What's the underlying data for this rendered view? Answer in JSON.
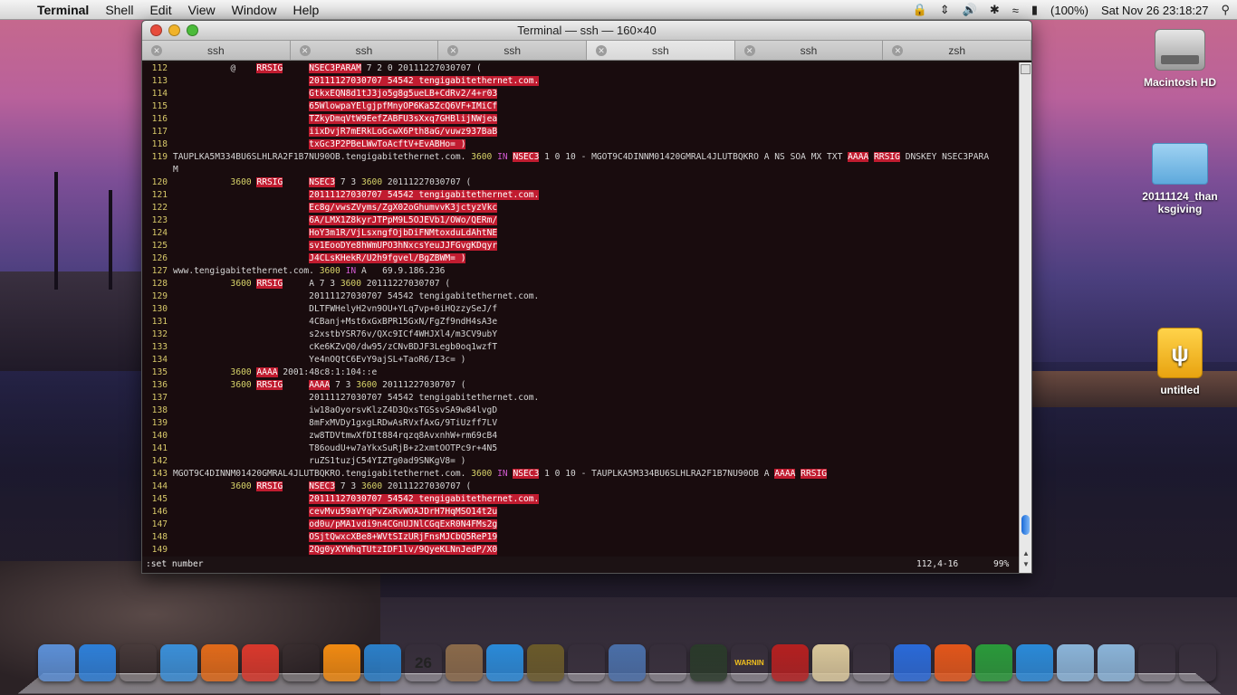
{
  "menubar": {
    "app_name": "Terminal",
    "menus": [
      "Shell",
      "Edit",
      "View",
      "Window",
      "Help"
    ],
    "battery": "(100%)",
    "clock": "Sat Nov 26  23:18:27"
  },
  "desktop": {
    "icons": [
      "Macintosh HD",
      "20111124_thanksgiving",
      "untitled"
    ],
    "icon_label_2a": "20111124_than",
    "icon_label_2b": "ksgiving"
  },
  "window": {
    "title": "Terminal — ssh — 160×40",
    "tabs": [
      "ssh",
      "ssh",
      "ssh",
      "ssh",
      "ssh",
      "zsh"
    ],
    "active_tab": 3
  },
  "terminal": {
    "lines": [
      {
        "n": "112",
        "t": "           @    RRSIG     NSEC3PARAM 7 2 0 20111227030707 ("
      },
      {
        "n": "113",
        "t": "                          20111127030707 54542 tengigabitethernet.com."
      },
      {
        "n": "114",
        "t": "                          GtkxEQN8d1tJ3jo5g8g5ueLB+CdRv2/4+r03"
      },
      {
        "n": "115",
        "t": "                          65WlowpaYElgjpfMnyOP6Ka5ZcQ6VF+IMiCf"
      },
      {
        "n": "116",
        "t": "                          TZkyDmqVtW9EefZABFU3sXxq7GHBlijNWjea"
      },
      {
        "n": "117",
        "t": "                          iixDvjR7mERkLoGcwX6Pth8aG/vuwz937BaB"
      },
      {
        "n": "118",
        "t": "                          txGc3P2PBeLWwToAcftV+EvABHo= )"
      },
      {
        "n": "119",
        "t": "TAUPLKA5M334BU6SLHLRA2F1B7NU90OB.tengigabitethernet.com. 3600 IN NSEC3 1 0 10 - MGOT9C4DINNM01420GMRAL4JLUTBQKRO A NS SOA MX TXT AAAA RRSIG DNSKEY NSEC3PARA"
      },
      {
        "n": "",
        "t": "M"
      },
      {
        "n": "120",
        "t": "           3600 RRSIG     NSEC3 7 3 3600 20111227030707 ("
      },
      {
        "n": "121",
        "t": "                          20111127030707 54542 tengigabitethernet.com."
      },
      {
        "n": "122",
        "t": "                          Ec8g/vwsZVyms/ZgX02oGhumvvK3jctyzVkc"
      },
      {
        "n": "123",
        "t": "                          6A/LMX1Z8kyrJTPpM9L5OJEVb1/OWo/QERm/"
      },
      {
        "n": "124",
        "t": "                          HoY3m1R/VjLsxngfOjbDiFNMtoxduLdAhtNE"
      },
      {
        "n": "125",
        "t": "                          sv1EooDYe8hWmUPO3hNxcsYeuJJFGvgKDqyr"
      },
      {
        "n": "126",
        "t": "                          J4CLsKHekR/U2h9fgvel/BgZBWM= )"
      },
      {
        "n": "127",
        "t": "www.tengigabitethernet.com. 3600 IN A   69.9.186.236"
      },
      {
        "n": "128",
        "t": "           3600 RRSIG     A 7 3 3600 20111227030707 ("
      },
      {
        "n": "129",
        "t": "                          20111127030707 54542 tengigabitethernet.com."
      },
      {
        "n": "130",
        "t": "                          DLTFWHelyH2vn9OU+YLq7vp+0iHQzzySeJ/f"
      },
      {
        "n": "131",
        "t": "                          4CBanj+Mst6xGxBPR15GxN/FgZf9ndH4sA3e"
      },
      {
        "n": "132",
        "t": "                          s2xstbYSR76v/QXc9ICf4WHJXl4/m3CV9ubY"
      },
      {
        "n": "133",
        "t": "                          cKe6KZvQ0/dw95/zCNvBDJF3Legb0oq1wzfT"
      },
      {
        "n": "134",
        "t": "                          Ye4nOQtC6EvY9ajSL+TaoR6/I3c= )"
      },
      {
        "n": "135",
        "t": "           3600 AAAA 2001:48c8:1:104::e"
      },
      {
        "n": "136",
        "t": "           3600 RRSIG     AAAA 7 3 3600 20111227030707 ("
      },
      {
        "n": "137",
        "t": "                          20111127030707 54542 tengigabitethernet.com."
      },
      {
        "n": "138",
        "t": "                          iw18aOyorsvKlzZ4D3QxsTGSsvSA9w84lvgD"
      },
      {
        "n": "139",
        "t": "                          8mFxMVDy1gxgLRDwAsRVxfAxG/9TiUzff7LV"
      },
      {
        "n": "140",
        "t": "                          zw8TDVtmwXfDIt884rqzq8AvxnhW+rm69cB4"
      },
      {
        "n": "141",
        "t": "                          T86oudU+w7aYkxSuRjB+z2xmtOOTPc9r+4N5"
      },
      {
        "n": "142",
        "t": "                          ruZS1tuzjC54YIZTg0ad9SNKgV8= )"
      },
      {
        "n": "143",
        "t": "MGOT9C4DINNM01420GMRAL4JLUTBQKRO.tengigabitethernet.com. 3600 IN NSEC3 1 0 10 - TAUPLKA5M334BU6SLHLRA2F1B7NU90OB A AAAA RRSIG"
      },
      {
        "n": "144",
        "t": "           3600 RRSIG     NSEC3 7 3 3600 20111227030707 ("
      },
      {
        "n": "145",
        "t": "                          20111127030707 54542 tengigabitethernet.com."
      },
      {
        "n": "146",
        "t": "                          cevMvu59aVYqPvZxRvWOAJDrH7HqMSO14t2u"
      },
      {
        "n": "147",
        "t": "                          od0u/pMA1vdi9n4CGnUJNlCGqExR0N4FMs2g"
      },
      {
        "n": "148",
        "t": "                          OSjtQwxcXBe8+WVtSIzURjFnsMJCbQ5ReP19"
      },
      {
        "n": "149",
        "t": "                          2Qg0yXYWhqTUtzIDF1lv/9QyeKLNnJedP/X0"
      }
    ],
    "command": ":set number",
    "position": "112,4-16",
    "percent": "99%"
  },
  "dock": {
    "apps": [
      "Finder",
      "App Store",
      "Dashboard",
      "Safari",
      "Firefox",
      "Chrome",
      "Terminal",
      "VLC",
      "QuickTime",
      "iCal",
      "Preview",
      "iTunes",
      "Time Machine",
      "Remote",
      "VirtualBox",
      "X11",
      "Activity Monitor",
      "Console",
      "Photo Booth",
      "Script Editor",
      "System Preferences",
      "Word",
      "PowerPoint",
      "Excel",
      "Internet Explorer",
      "Applications",
      "Documents",
      "Downloads",
      "Trash"
    ],
    "ical_day": "26",
    "console_text": "WARNIN"
  }
}
